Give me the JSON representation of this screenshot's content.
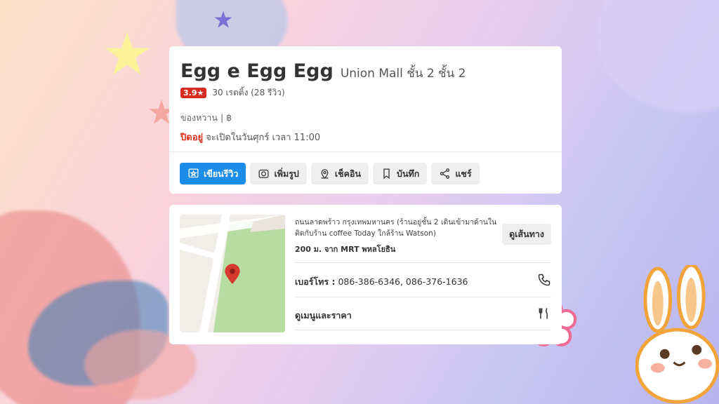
{
  "restaurant": {
    "name": "Egg e Egg Egg",
    "location": "Union Mall ชั้น 2 ชั้น 2",
    "rating": "3.9★",
    "rating_count": "30 เรตติ้ง (28 รีวิว)",
    "category": "ของหวาน | ฿",
    "status": "ปิดอยู่",
    "open_info": "จะเปิดในวันศุกร์ เวลา 11:00"
  },
  "actions": {
    "review": "เขียนรีวิว",
    "photo": "เพิ่มรูป",
    "checkin": "เช็คอิน",
    "save": "บันทึก",
    "share": "แชร์"
  },
  "details": {
    "address_line1": "ถนนลาดพร้าว กรุงเทพมหานคร (ร้านอยู่ชั้น 2 เดินเข้ามาด้านใน",
    "address_line2": "ติดกับร้าน coffee Today ใกล้ร้าน Watson)",
    "nearby": "200 ม. จาก MRT พหลโยธิน",
    "route_label": "ดูเส้นทาง",
    "phone_label": "เบอร์โทร :",
    "phone_numbers": "086-386-6346, 086-376-1636",
    "menu_label": "ดูเมนูและราคา"
  },
  "icons": [
    "review-icon",
    "camera-icon",
    "checkin-pin-icon",
    "bookmark-icon",
    "share-icon",
    "map-pin-icon",
    "phone-icon",
    "cutlery-icon"
  ],
  "colors": {
    "primary": "#1b8ce8",
    "rating_badge": "#d62b20",
    "closed": "#e0311f"
  }
}
